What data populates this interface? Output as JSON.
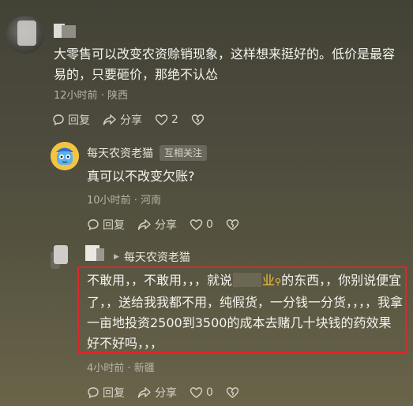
{
  "comment1": {
    "text": "大零售可以改变农资赊销现象，这样想来挺好的。低价是最容易的，只要砸价，那绝不认怂",
    "time": "12小时前",
    "location": "陕西",
    "reply_label": "回复",
    "share_label": "分享",
    "like_count": "2"
  },
  "reply1": {
    "nickname": "每天农资老猫",
    "badge": "互相关注",
    "text": "真可以不改变欠账?",
    "time": "10小时前",
    "location": "河南",
    "reply_label": "回复",
    "share_label": "分享",
    "like_count": "0"
  },
  "reply2": {
    "reply_to": "每天农资老猫",
    "text_part1": "不敢用，，不敢用，，，就说",
    "keyword": "业",
    "text_part2": "的东西，，你别说便宜了，，送给我我都不用，纯假货，一分钱一分货，，，，我拿一亩地投资2500到3500的成本去赌几十块钱的药效果好不好吗，，，",
    "time": "4小时前",
    "location": "新疆",
    "reply_label": "回复",
    "share_label": "分享",
    "like_count": "0"
  },
  "colors": {
    "highlight_border": "#e0262a",
    "keyword": "#f0c23a"
  }
}
